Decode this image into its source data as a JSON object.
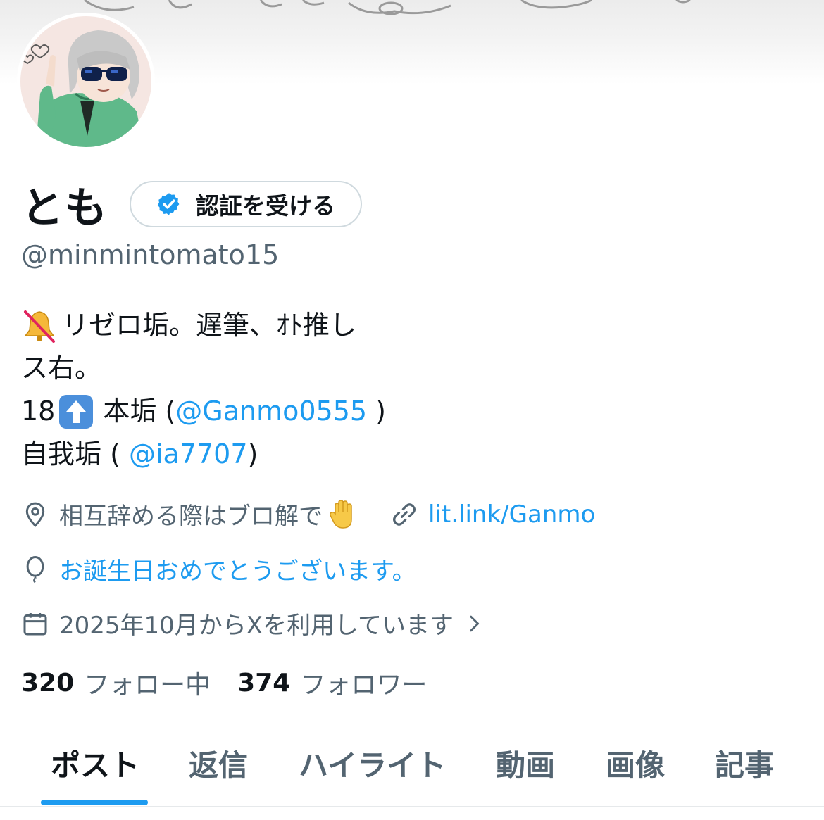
{
  "profile": {
    "display_name": "とも",
    "verify_button_label": "認証を受ける",
    "handle": "@minmintomato15"
  },
  "bio": {
    "line1": "リゼロ垢。遅筆、ｵﾄ推し",
    "line2": "ス右。",
    "line3_prefix": "18",
    "line3_text": "本垢 (",
    "line3_mention": "@Ganmo0555",
    "line3_suffix": " )",
    "line4_prefix": "自我垢 ( ",
    "line4_mention": "@ia7707",
    "line4_suffix": ")"
  },
  "meta": {
    "location": "相互辞める際はブロ解で",
    "link": "lit.link/Ganmo",
    "birthday": "お誕生日おめでとうございます。",
    "joined": "2025年10月からXを利用しています"
  },
  "stats": {
    "following_count": "320",
    "following_label": "フォロー中",
    "followers_count": "374",
    "followers_label": "フォロワー"
  },
  "tabs": [
    {
      "label": "ポスト",
      "active": true
    },
    {
      "label": "返信",
      "active": false
    },
    {
      "label": "ハイライト",
      "active": false
    },
    {
      "label": "動画",
      "active": false
    },
    {
      "label": "画像",
      "active": false
    },
    {
      "label": "記事",
      "active": false
    }
  ],
  "colors": {
    "accent": "#1d9bf0",
    "text_primary": "#0f1419",
    "text_secondary": "#536471",
    "border": "#cfd9de"
  },
  "icons": {
    "verified": "verified-badge-icon",
    "muted_bell": "muted-bell-icon",
    "up_arrow": "up-arrow-emoji-icon",
    "location": "location-pin-icon",
    "raised_hand": "raised-hand-emoji-icon",
    "link": "link-icon",
    "balloon": "balloon-icon",
    "calendar": "calendar-icon",
    "chevron": "chevron-right-icon"
  }
}
